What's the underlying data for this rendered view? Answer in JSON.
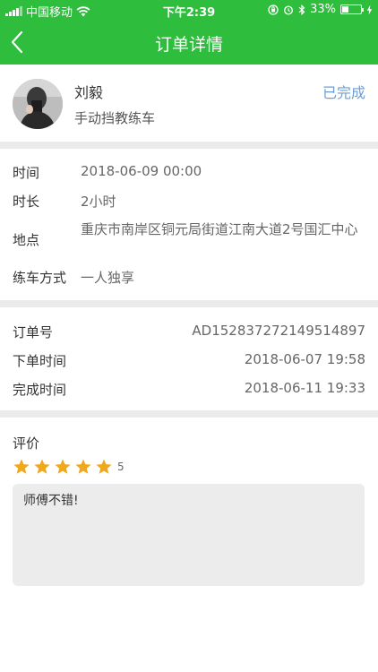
{
  "status_bar": {
    "carrier": "中国移动",
    "time": "下午2:39",
    "battery": "33%",
    "battery_level": 0.33
  },
  "nav": {
    "title": "订单详情"
  },
  "profile": {
    "name": "刘毅",
    "subtitle": "手动挡教练车",
    "status": "已完成"
  },
  "details": {
    "time_label": "时间",
    "time_value": "2018-06-09 00:00",
    "duration_label": "时长",
    "duration_value": "2小时",
    "location_label": "地点",
    "location_value": "重庆市南岸区铜元局街道江南大道2号国汇中心",
    "mode_label": "练车方式",
    "mode_value": "一人独享"
  },
  "order": {
    "order_no_label": "订单号",
    "order_no_value": "AD152837272149514897",
    "placed_label": "下单时间",
    "placed_value": "2018-06-07 19:58",
    "completed_label": "完成时间",
    "completed_value": "2018-06-11 19:33"
  },
  "review": {
    "label": "评价",
    "rating": 5,
    "rating_text": "5",
    "comment": "师傅不错!"
  },
  "colors": {
    "brand_green": "#2ebd3c",
    "status_blue": "#6a9ed6",
    "star": "#f0a81c"
  }
}
